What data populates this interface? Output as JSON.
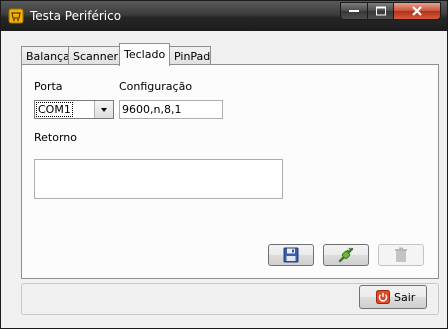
{
  "window": {
    "title": "Testa Periférico"
  },
  "tabs": [
    {
      "label": "Balança"
    },
    {
      "label": "Scanner"
    },
    {
      "label": "Teclado"
    },
    {
      "label": "PinPad"
    }
  ],
  "active_tab": "Teclado",
  "form": {
    "porta_label": "Porta",
    "porta_value": "COM1",
    "config_label": "Configuração",
    "config_value": "9600,n,8,1",
    "retorno_label": "Retorno",
    "retorno_value": ""
  },
  "actions": {
    "save_icon": "floppy-disk-icon",
    "connect_icon": "plug-icon",
    "delete_icon": "trash-icon",
    "delete_enabled": false
  },
  "footer": {
    "sair_label": "Sair",
    "sair_icon": "power-icon"
  },
  "colors": {
    "titlebar": "#262626",
    "close": "#c8523b",
    "panel": "#fcfcfc"
  }
}
